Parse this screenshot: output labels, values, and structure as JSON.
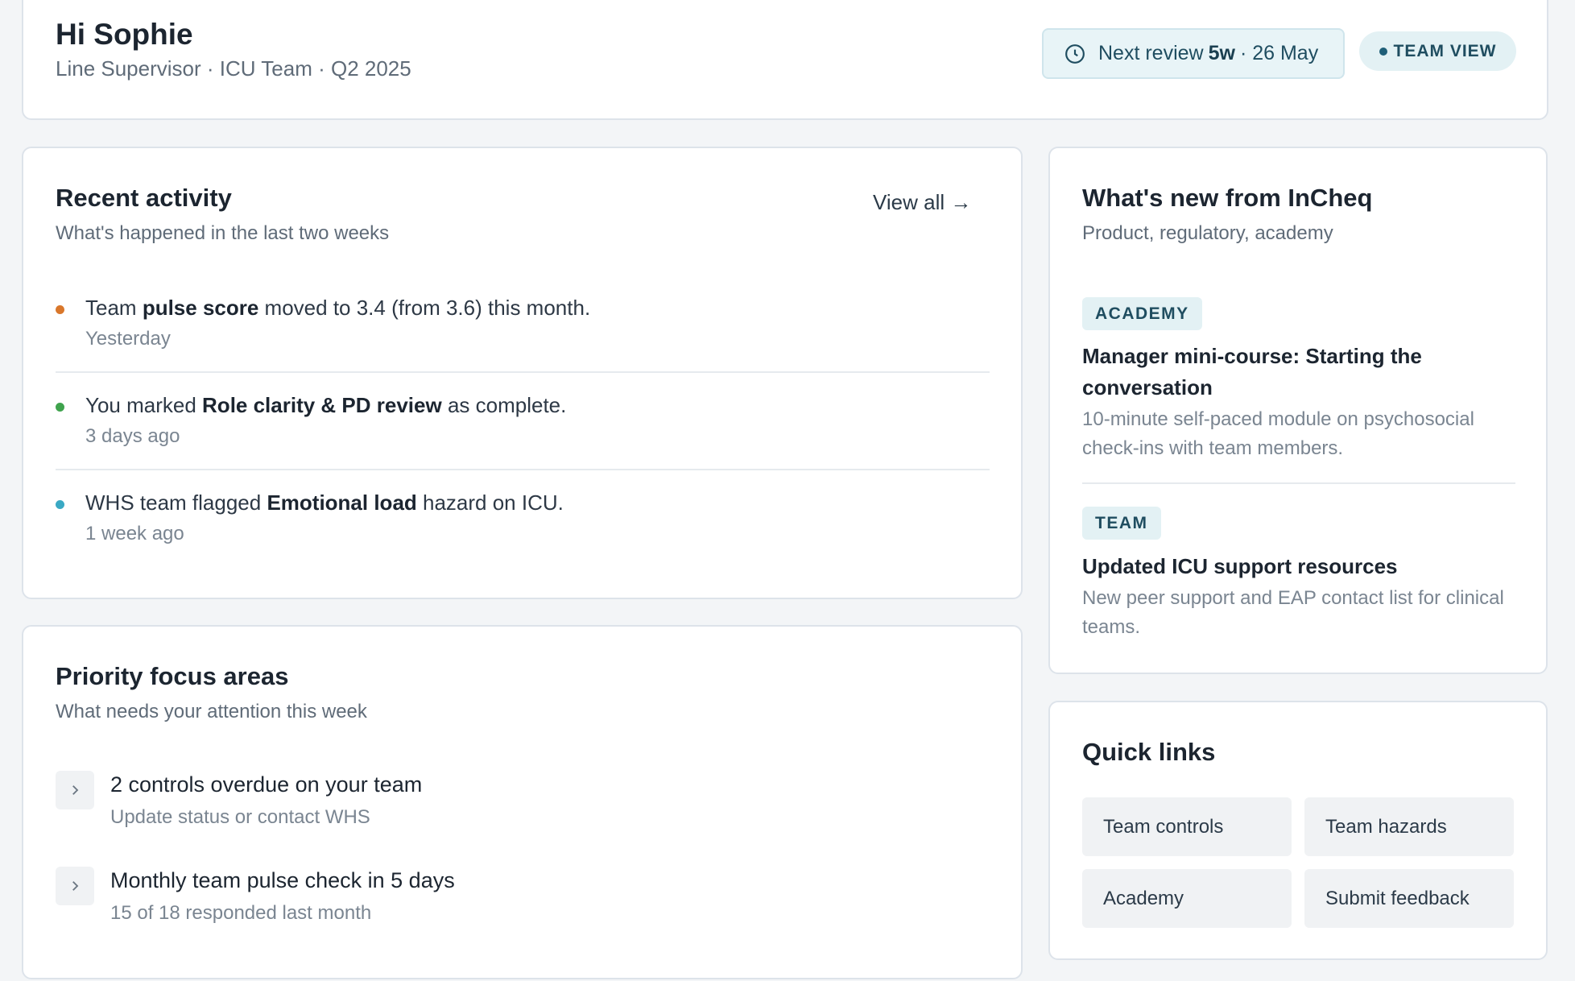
{
  "header": {
    "greeting": "Hi Sophie",
    "role_line": "Line Supervisor · ICU Team · Q2 2025",
    "review": {
      "prefix": "Next review",
      "bold": "5w",
      "suffix": "· 26 May"
    },
    "team_view": "TEAM VIEW"
  },
  "activity": {
    "title": "Recent activity",
    "subtitle": "What's happened in the last two weeks",
    "view_all": "View all →",
    "items": [
      {
        "pre": "Team ",
        "bold": "pulse score",
        "post": " moved to 3.4 (from 3.6) this month.",
        "time": "Yesterday",
        "color": "#d9772b"
      },
      {
        "pre": "You marked ",
        "bold": "Role clarity & PD review",
        "post": " as complete.",
        "time": "3 days ago",
        "color": "#3fa34d"
      },
      {
        "pre": "WHS team flagged ",
        "bold": "Emotional load",
        "post": " hazard on ICU.",
        "time": "1 week ago",
        "color": "#3aa9c4"
      }
    ]
  },
  "priority": {
    "title": "Priority focus areas",
    "subtitle": "What needs your attention this week",
    "items": [
      {
        "title": "2 controls overdue on your team",
        "subtitle": "Update status or contact WHS"
      },
      {
        "title": "Monthly team pulse check in 5 days",
        "subtitle": "15 of 18 responded last month"
      }
    ]
  },
  "news": {
    "title": "What's new from InCheq",
    "subtitle": "Product, regulatory, academy",
    "items": [
      {
        "tag": "ACADEMY",
        "title": "Manager mini-course: Starting the conversation",
        "desc": "10-minute self-paced module on psychosocial check-ins with team members."
      },
      {
        "tag": "TEAM",
        "title": "Updated ICU support resources",
        "desc": "New peer support and EAP contact list for clinical teams."
      }
    ]
  },
  "quick_links": {
    "title": "Quick links",
    "items": [
      "Team controls",
      "Team hazards",
      "Academy",
      "Submit feedback"
    ]
  }
}
